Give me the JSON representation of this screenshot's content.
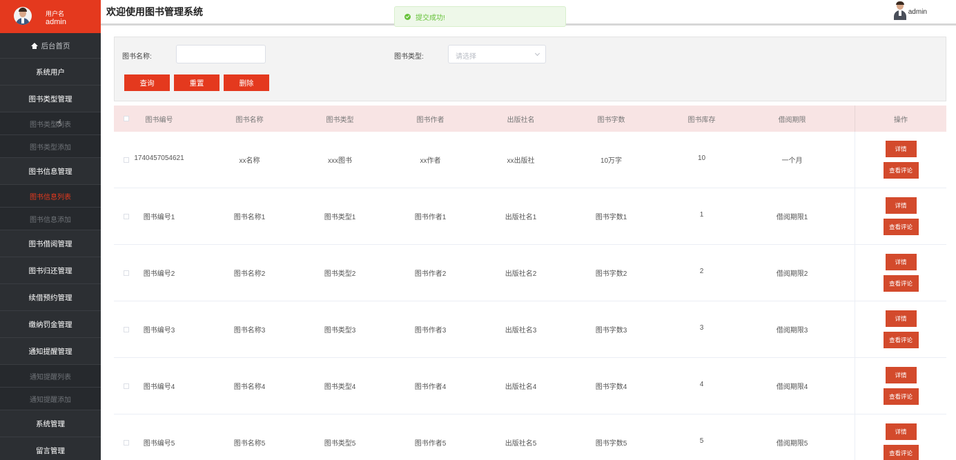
{
  "sidebar": {
    "user_label": "用户名",
    "user_name": "admin",
    "home": "后台首页",
    "items": [
      {
        "label": "系统用户",
        "type": "main"
      },
      {
        "label": "图书类型管理",
        "type": "main"
      },
      {
        "label": "图书类型列表",
        "type": "sub"
      },
      {
        "label": "图书类型添加",
        "type": "sub"
      },
      {
        "label": "图书信息管理",
        "type": "main"
      },
      {
        "label": "图书信息列表",
        "type": "sub-active"
      },
      {
        "label": "图书信息添加",
        "type": "sub"
      },
      {
        "label": "图书借阅管理",
        "type": "main"
      },
      {
        "label": "图书归还管理",
        "type": "main"
      },
      {
        "label": "续借预约管理",
        "type": "main"
      },
      {
        "label": "缴纳罚金管理",
        "type": "main"
      },
      {
        "label": "通知提醒管理",
        "type": "main"
      },
      {
        "label": "通知提醒列表",
        "type": "sub"
      },
      {
        "label": "通知提醒添加",
        "type": "sub"
      },
      {
        "label": "系统管理",
        "type": "main"
      },
      {
        "label": "留言管理",
        "type": "main"
      }
    ]
  },
  "header": {
    "title": "欢迎使用图书管理系统",
    "user": "admin"
  },
  "toast": {
    "message": "提交成功!"
  },
  "search": {
    "name_label": "图书名称:",
    "name_value": "",
    "type_label": "图书类型:",
    "type_placeholder": "请选择",
    "query": "查询",
    "reset": "重置",
    "delete": "删除"
  },
  "table": {
    "columns": [
      "图书编号",
      "图书名称",
      "图书类型",
      "图书作者",
      "出版社名",
      "图书字数",
      "图书库存",
      "借阅期限",
      "操作"
    ],
    "detail_label": "详情",
    "review_label": "查看评论",
    "rows": [
      [
        "1740457054621",
        "xx名称",
        "xxx图书",
        "xx作者",
        "xx出版社",
        "10万字",
        "10",
        "一个月"
      ],
      [
        "图书编号1",
        "图书名称1",
        "图书类型1",
        "图书作者1",
        "出版社名1",
        "图书字数1",
        "1",
        "借阅期限1"
      ],
      [
        "图书编号2",
        "图书名称2",
        "图书类型2",
        "图书作者2",
        "出版社名2",
        "图书字数2",
        "2",
        "借阅期限2"
      ],
      [
        "图书编号3",
        "图书名称3",
        "图书类型3",
        "图书作者3",
        "出版社名3",
        "图书字数3",
        "3",
        "借阅期限3"
      ],
      [
        "图书编号4",
        "图书名称4",
        "图书类型4",
        "图书作者4",
        "出版社名4",
        "图书字数4",
        "4",
        "借阅期限4"
      ],
      [
        "图书编号5",
        "图书名称5",
        "图书类型5",
        "图书作者5",
        "出版社名5",
        "图书字数5",
        "5",
        "借阅期限5"
      ]
    ]
  },
  "colors": {
    "accent": "#e4391e",
    "sidebar_bg": "#2c2f33",
    "success": "#67c23a",
    "table_header_bg": "#f8e4e4"
  }
}
